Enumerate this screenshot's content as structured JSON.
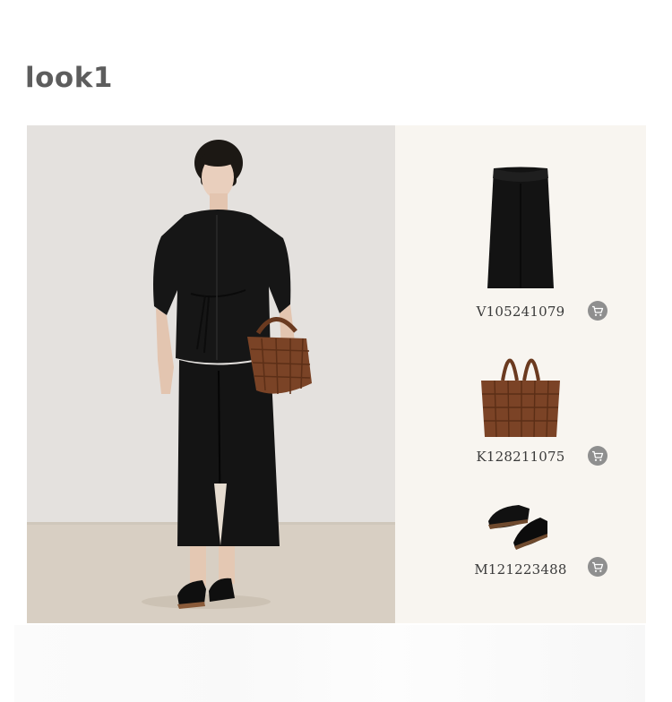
{
  "look": {
    "title": "look1"
  },
  "products": [
    {
      "code": "V105241079",
      "item": "skirt-image",
      "cart_icon": "cart-icon"
    },
    {
      "code": "K128211075",
      "item": "bag-image",
      "cart_icon": "cart-icon"
    },
    {
      "code": "M121223488",
      "item": "shoes-image",
      "cart_icon": "cart-icon"
    }
  ],
  "colors": {
    "title_text": "#5d5d5d",
    "product_panel_bg": "#f8f5f0",
    "cart_button_bg": "#8f8f8f",
    "garment_black": "#151515",
    "bag_brown": "#7a4326",
    "photo_wall": "#e6e3e1",
    "photo_floor": "#d7cfc2"
  }
}
